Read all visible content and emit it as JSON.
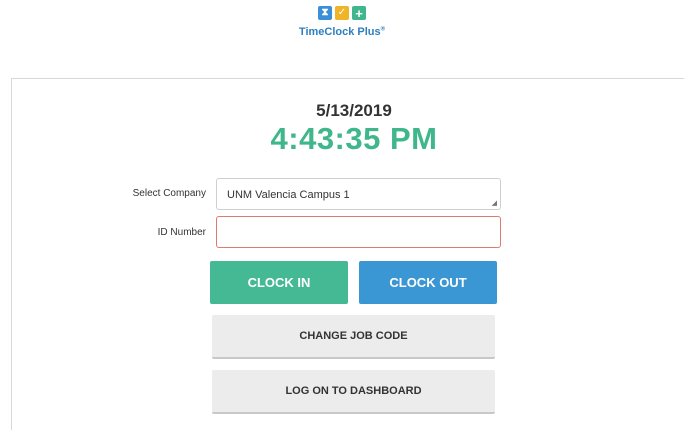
{
  "logo": {
    "icons": [
      "hourglass-icon",
      "checkmark-icon",
      "plus-icon"
    ],
    "text": "TimeClock Plus",
    "registered": "®"
  },
  "clock": {
    "date": "5/13/2019",
    "time": "4:43:35 PM"
  },
  "form": {
    "company_label": "Select Company",
    "company_value": "UNM Valencia Campus  1",
    "id_label": "ID Number",
    "id_value": ""
  },
  "buttons": {
    "clock_in": "CLOCK IN",
    "clock_out": "CLOCK OUT",
    "change_job_code": "CHANGE JOB CODE",
    "log_on_dashboard": "LOG ON TO DASHBOARD"
  },
  "colors": {
    "accent_green": "#45b993",
    "accent_blue": "#3a97d4",
    "time_green": "#3fb68b",
    "error_border": "#e07a6e"
  }
}
